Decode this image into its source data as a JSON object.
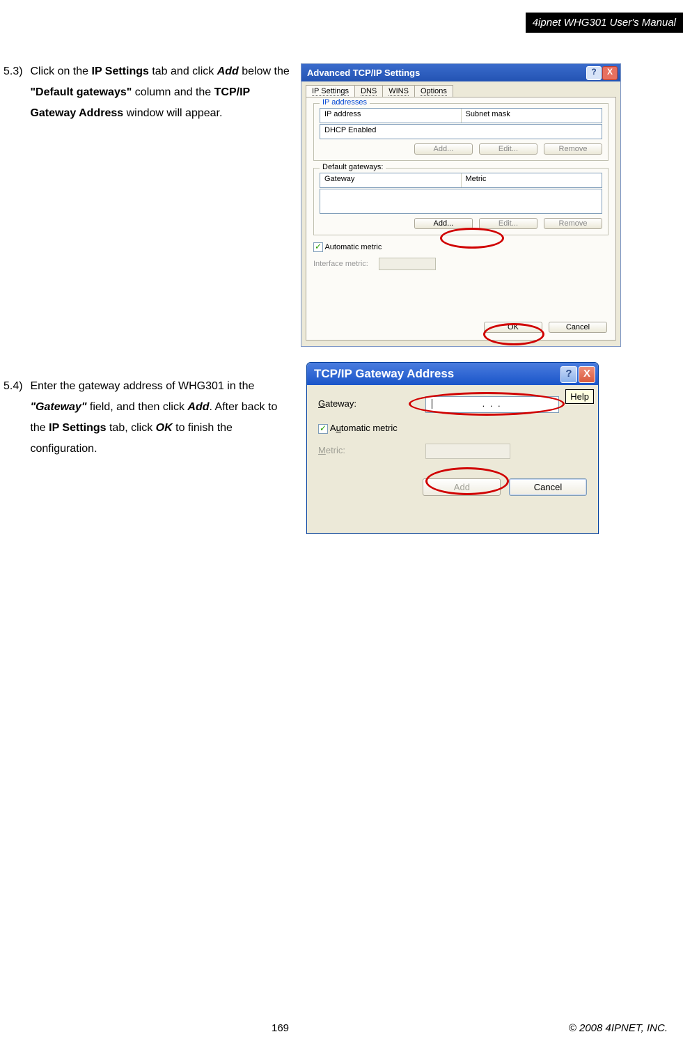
{
  "header": {
    "title": "4ipnet WHG301 User's Manual"
  },
  "footer": {
    "page": "169",
    "copyright": "© 2008 4IPNET, INC."
  },
  "step53": {
    "num": "5.3)",
    "text_prefix": "Click on the ",
    "bold1": "IP Settings",
    "text_mid1": " tab and click ",
    "italic1": "Add",
    "text_mid2": " below the ",
    "bold2": "\"Default gateways\"",
    "text_mid3": " column and the ",
    "bold3": "TCP/IP Gateway Address",
    "text_end": " window will appear."
  },
  "step54": {
    "num": "5.4)",
    "text_prefix": "Enter the gateway address of WHG301 in the ",
    "bold1": "\"Gateway\"",
    "text_mid1": " field, and then click ",
    "italic1": "Add",
    "text_mid2": ". After back to the ",
    "bold2": "IP Settings",
    "text_mid3": " tab, click ",
    "italic2": "OK",
    "text_end": " to finish the configuration."
  },
  "win1": {
    "title": "Advanced TCP/IP Settings",
    "help": "?",
    "close": "X",
    "tabs": {
      "t1": "IP Settings",
      "t2": "DNS",
      "t3": "WINS",
      "t4": "Options"
    },
    "group1": {
      "title": "IP addresses",
      "col1": "IP address",
      "col2": "Subnet mask",
      "row1": "DHCP Enabled",
      "btn_add": "Add...",
      "btn_edit": "Edit...",
      "btn_remove": "Remove"
    },
    "group2": {
      "title": "Default gateways:",
      "col1": "Gateway",
      "col2": "Metric",
      "btn_add": "Add...",
      "btn_edit": "Edit...",
      "btn_remove": "Remove"
    },
    "auto_metric": "Automatic metric",
    "interface_metric": "Interface metric:",
    "ok": "OK",
    "cancel": "Cancel"
  },
  "win2": {
    "title": "TCP/IP Gateway Address",
    "help": "?",
    "close": "X",
    "helpbox": "Help",
    "gateway_label": "Gateway:",
    "ip_dots": ".      .      .",
    "auto_metric": "Automatic metric",
    "metric_label": "Metric:",
    "btn_add": "Add",
    "btn_cancel": "Cancel"
  }
}
